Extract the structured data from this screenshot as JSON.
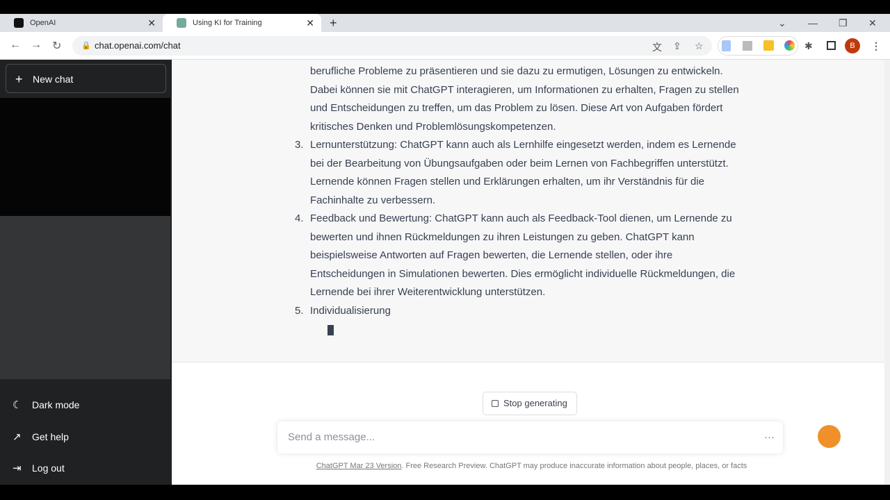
{
  "browser": {
    "tabs": [
      {
        "title": "OpenAI"
      },
      {
        "title": "Using KI for Training"
      }
    ],
    "url": "chat.openai.com/chat",
    "profile_initial": "B"
  },
  "sidebar": {
    "new_chat": "New chat",
    "items": [
      {
        "label": "Dark mode",
        "icon": "moon-icon"
      },
      {
        "label": "Get help",
        "icon": "external-link-icon"
      },
      {
        "label": "Log out",
        "icon": "logout-icon"
      }
    ]
  },
  "message": {
    "items": [
      {
        "num": "",
        "text": "berufliche Probleme zu präsentieren und sie dazu zu ermutigen, Lösungen zu entwickeln. Dabei können sie mit ChatGPT interagieren, um Informationen zu erhalten, Fragen zu stellen und Entscheidungen zu treffen, um das Problem zu lösen. Diese Art von Aufgaben fördert kritisches Denken und Problemlösungskompetenzen."
      },
      {
        "num": "3.",
        "text": "Lernunterstützung: ChatGPT kann auch als Lernhilfe eingesetzt werden, indem es Lernende bei der Bearbeitung von Übungsaufgaben oder beim Lernen von Fachbegriffen unterstützt. Lernende können Fragen stellen und Erklärungen erhalten, um ihr Verständnis für die Fachinhalte zu verbessern."
      },
      {
        "num": "4.",
        "text": "Feedback und Bewertung: ChatGPT kann auch als Feedback-Tool dienen, um Lernende zu bewerten und ihnen Rückmeldungen zu ihren Leistungen zu geben. ChatGPT kann beispielsweise Antworten auf Fragen bewerten, die Lernende stellen, oder ihre Entscheidungen in Simulationen bewerten. Dies ermöglicht individuelle Rückmeldungen, die Lernende bei ihrer Weiterentwicklung unterstützen."
      },
      {
        "num": "5.",
        "text": "Individualisierung"
      }
    ]
  },
  "composer": {
    "stop_label": "Stop generating",
    "placeholder": "Send a message..."
  },
  "footer": {
    "version_link": "ChatGPT Mar 23 Version",
    "text": ". Free Research Preview. ChatGPT may produce inaccurate information about people, places, or facts"
  }
}
